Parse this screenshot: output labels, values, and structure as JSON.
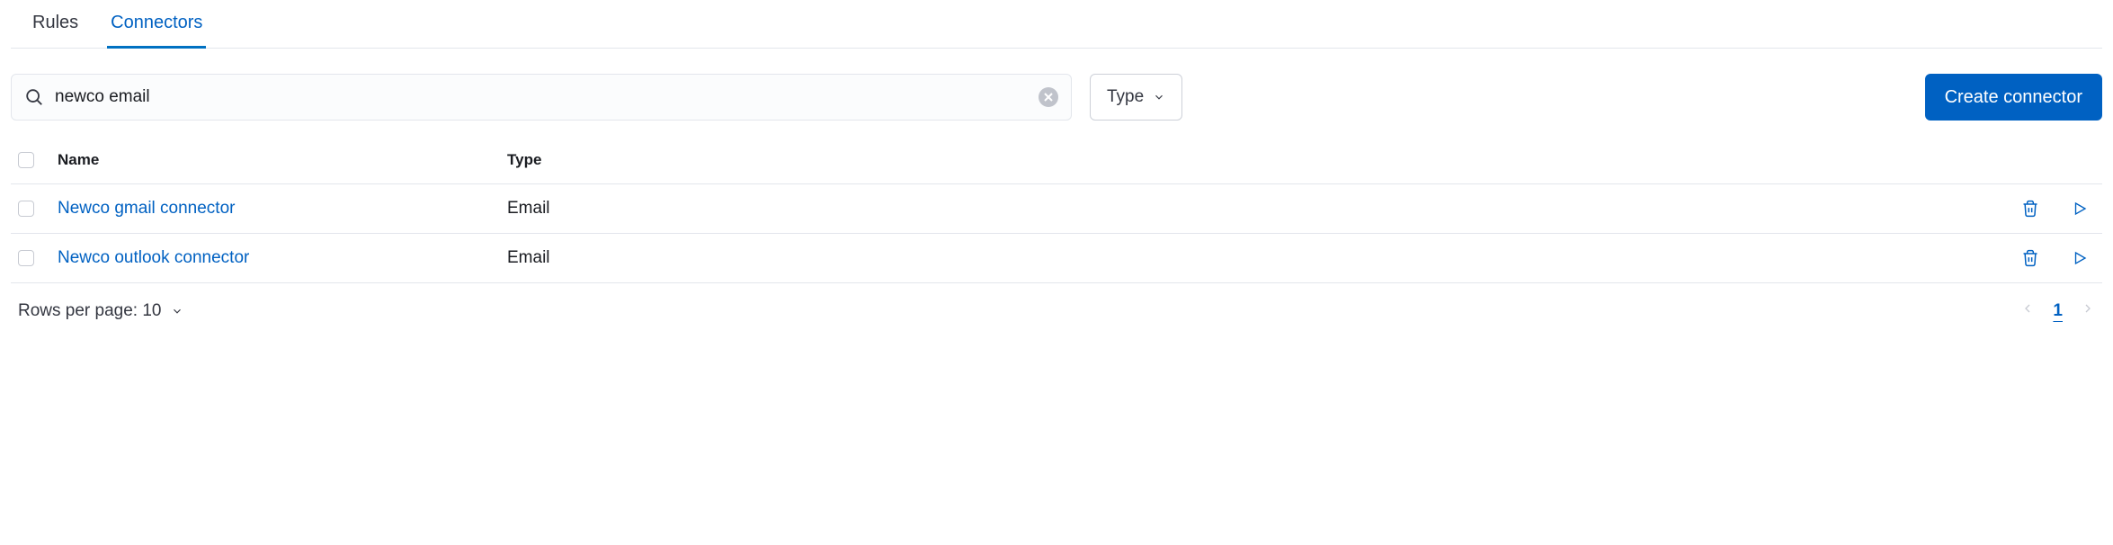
{
  "tabs": [
    {
      "label": "Rules",
      "active": false
    },
    {
      "label": "Connectors",
      "active": true
    }
  ],
  "search": {
    "value": "newco email"
  },
  "typeFilter": {
    "label": "Type"
  },
  "createButton": {
    "label": "Create connector"
  },
  "columns": {
    "name": "Name",
    "type": "Type"
  },
  "rows": [
    {
      "name": "Newco gmail connector",
      "type": "Email"
    },
    {
      "name": "Newco outlook connector",
      "type": "Email"
    }
  ],
  "footer": {
    "rowsPerPageLabel": "Rows per page: 10",
    "currentPage": "1"
  }
}
